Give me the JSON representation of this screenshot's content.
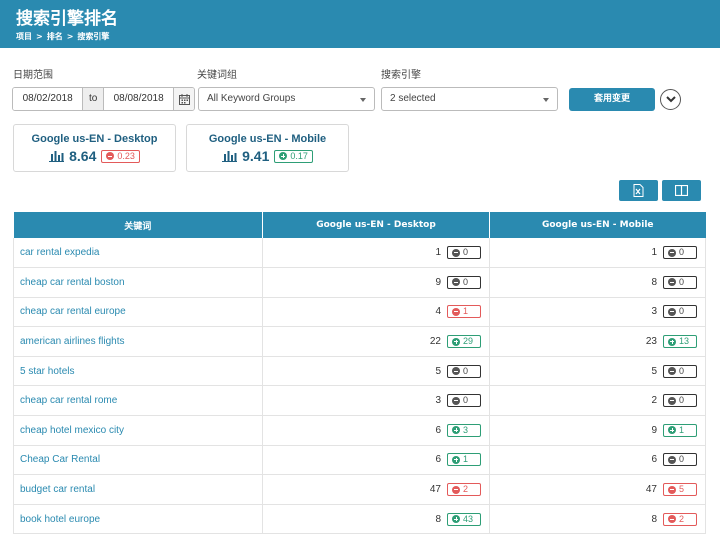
{
  "header": {
    "title": "搜索引擎排名",
    "breadcrumb": [
      "项目",
      "排名",
      "搜索引擎"
    ],
    "separator": ">"
  },
  "filters": {
    "date_label": "日期范围",
    "keyword_group_label": "关键词组",
    "engine_label": "搜索引擎",
    "date_from": "08/02/2018",
    "date_to_word": "to",
    "date_to": "08/08/2018",
    "keyword_group_value": "All Keyword Groups",
    "engine_value": "2 selected",
    "apply_label": "套用变更"
  },
  "summary_cards": [
    {
      "title": "Google us-EN - Desktop",
      "value": "8.64",
      "change": "0.23",
      "direction": "down"
    },
    {
      "title": "Google us-EN - Mobile",
      "value": "9.41",
      "change": "0.17",
      "direction": "up"
    }
  ],
  "table": {
    "headers": [
      "关键词",
      "Google us-EN - Desktop",
      "Google us-EN - Mobile"
    ],
    "rows": [
      {
        "keyword": "car rental expedia",
        "desktop": "1",
        "d_change": "0",
        "d_dir": "flat",
        "mobile": "1",
        "m_change": "0",
        "m_dir": "flat"
      },
      {
        "keyword": "cheap car rental boston",
        "desktop": "9",
        "d_change": "0",
        "d_dir": "flat",
        "mobile": "8",
        "m_change": "0",
        "m_dir": "flat"
      },
      {
        "keyword": "cheap car rental europe",
        "desktop": "4",
        "d_change": "1",
        "d_dir": "down",
        "mobile": "3",
        "m_change": "0",
        "m_dir": "flat"
      },
      {
        "keyword": "american airlines flights",
        "desktop": "22",
        "d_change": "29",
        "d_dir": "up",
        "mobile": "23",
        "m_change": "13",
        "m_dir": "up"
      },
      {
        "keyword": "5 star hotels",
        "desktop": "5",
        "d_change": "0",
        "d_dir": "flat",
        "mobile": "5",
        "m_change": "0",
        "m_dir": "flat"
      },
      {
        "keyword": "cheap car rental rome",
        "desktop": "3",
        "d_change": "0",
        "d_dir": "flat",
        "mobile": "2",
        "m_change": "0",
        "m_dir": "flat"
      },
      {
        "keyword": "cheap hotel mexico city",
        "desktop": "6",
        "d_change": "3",
        "d_dir": "up",
        "mobile": "9",
        "m_change": "1",
        "m_dir": "up"
      },
      {
        "keyword": "Cheap Car Rental",
        "desktop": "6",
        "d_change": "1",
        "d_dir": "up",
        "mobile": "6",
        "m_change": "0",
        "m_dir": "flat"
      },
      {
        "keyword": "budget car rental",
        "desktop": "47",
        "d_change": "2",
        "d_dir": "down",
        "mobile": "47",
        "m_change": "5",
        "m_dir": "down"
      },
      {
        "keyword": "book hotel europe",
        "desktop": "8",
        "d_change": "43",
        "d_dir": "up",
        "mobile": "8",
        "m_change": "2",
        "m_dir": "down"
      }
    ]
  },
  "colors": {
    "primary": "#2a8ab0",
    "up": "#2e9e76",
    "down": "#e35a5a"
  },
  "icons": {
    "calendar": "calendar-icon",
    "dropdown": "caret-down-icon",
    "expand": "chevron-down-circle-icon",
    "export": "excel-export-icon",
    "columns": "columns-icon",
    "chart": "bar-chart-icon"
  }
}
